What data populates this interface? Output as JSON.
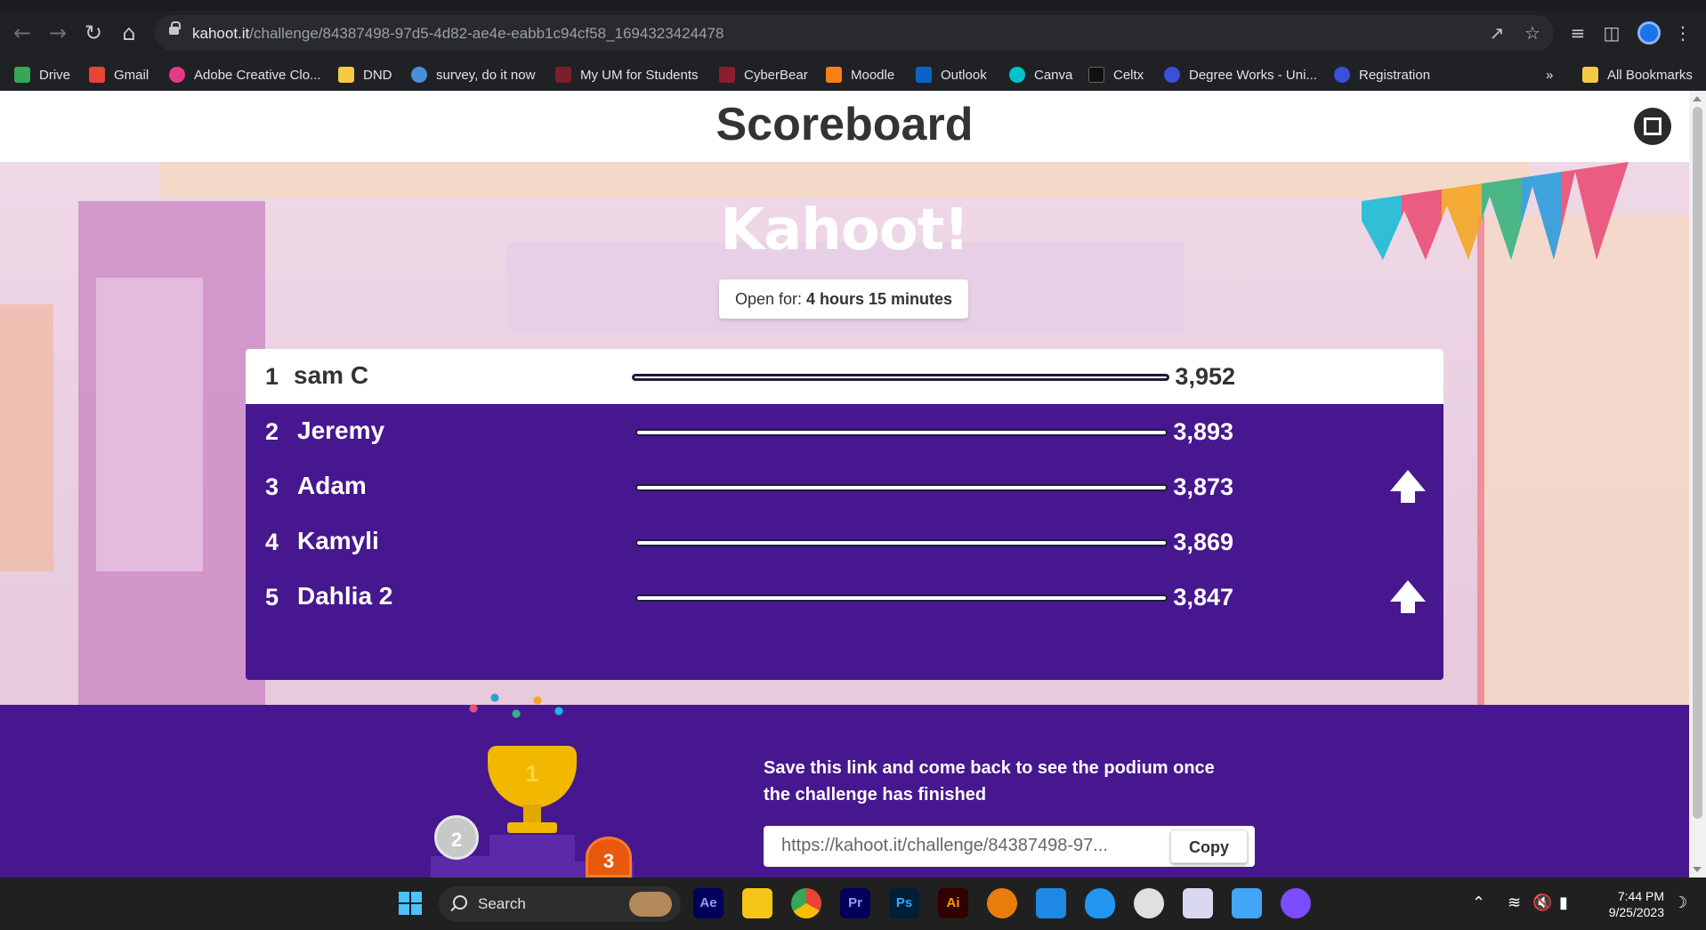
{
  "browser": {
    "url_host": "kahoot.it",
    "url_path": "/challenge/84387498-97d5-4d82-ae4e-eabb1c94cf58_1694323424478",
    "bookmarks": [
      {
        "label": "Drive",
        "color": "#34a853"
      },
      {
        "label": "Gmail",
        "color": "#ea4335"
      },
      {
        "label": "Adobe Creative Clo...",
        "color": "#e8388a"
      },
      {
        "label": "DND",
        "color": "#f6c943"
      },
      {
        "label": "survey, do it now",
        "color": "#4a90d9"
      },
      {
        "label": "My UM for Students",
        "color": "#7a1f2b"
      },
      {
        "label": "CyberBear",
        "color": "#8b1e2d"
      },
      {
        "label": "Moodle",
        "color": "#f98012"
      },
      {
        "label": "Outlook",
        "color": "#0a64c8"
      },
      {
        "label": "Canva",
        "color": "#00c4cc"
      },
      {
        "label": "Celtx",
        "color": "#111111"
      },
      {
        "label": "Degree Works - Uni...",
        "color": "#3b4fd8"
      },
      {
        "label": "Registration",
        "color": "#3b4fd8"
      }
    ],
    "more_label": "»",
    "all_bookmarks": "All Bookmarks"
  },
  "header": {
    "title": "Scoreboard"
  },
  "game": {
    "logo": "Kahoot!",
    "open_for_label": "Open for:",
    "open_for_value": "4 hours 15 minutes",
    "players": [
      {
        "rank": "1",
        "name": "sam C",
        "score": "3,952",
        "rank_up": false
      },
      {
        "rank": "2",
        "name": "Jeremy",
        "score": "3,893",
        "rank_up": false
      },
      {
        "rank": "3",
        "name": "Adam",
        "score": "3,873",
        "rank_up": true
      },
      {
        "rank": "4",
        "name": "Kamyli",
        "score": "3,869",
        "rank_up": false
      },
      {
        "rank": "5",
        "name": "Dahlia 2",
        "score": "3,847",
        "rank_up": true
      }
    ]
  },
  "footer": {
    "save_message": "Save this link and come back to see the podium once the challenge has finished",
    "link_value": "https://kahoot.it/challenge/84387498-97...",
    "copy_label": "Copy",
    "medal_2": "2",
    "medal_1": "1",
    "medal_3": "3"
  },
  "taskbar": {
    "search_label": "Search",
    "apps": [
      {
        "icon": "after-effects-icon",
        "label": "Ae",
        "color": "#00005b",
        "text": "#9999ff"
      },
      {
        "icon": "file-explorer-icon",
        "label": "",
        "color": "#f5c518",
        "text": "#fff"
      },
      {
        "icon": "chrome-icon",
        "label": "",
        "color": "#4285f4",
        "text": "#fff"
      },
      {
        "icon": "premiere-icon",
        "label": "Pr",
        "color": "#00005b",
        "text": "#9999ff"
      },
      {
        "icon": "photoshop-icon",
        "label": "Ps",
        "color": "#001e36",
        "text": "#31a8ff"
      },
      {
        "icon": "illustrator-icon",
        "label": "Ai",
        "color": "#330000",
        "text": "#ff9a00"
      },
      {
        "icon": "blender-icon",
        "label": "",
        "color": "#e87d0d",
        "text": "#fff"
      },
      {
        "icon": "pen-app-icon",
        "label": "",
        "color": "#1e88e5",
        "text": "#fff"
      },
      {
        "icon": "shield-app-icon",
        "label": "",
        "color": "#2196f3",
        "text": "#fff"
      },
      {
        "icon": "clock-app-icon",
        "label": "",
        "color": "#e0e0e0",
        "text": "#333"
      },
      {
        "icon": "snipping-tool-icon",
        "label": "",
        "color": "#d8d8f0",
        "text": "#c62828"
      },
      {
        "icon": "notepad-icon",
        "label": "",
        "color": "#42a5f5",
        "text": "#fff"
      },
      {
        "icon": "github-icon",
        "label": "",
        "color": "#7c4dff",
        "text": "#fff"
      }
    ],
    "time": "7:44 PM",
    "date": "9/25/2023"
  }
}
